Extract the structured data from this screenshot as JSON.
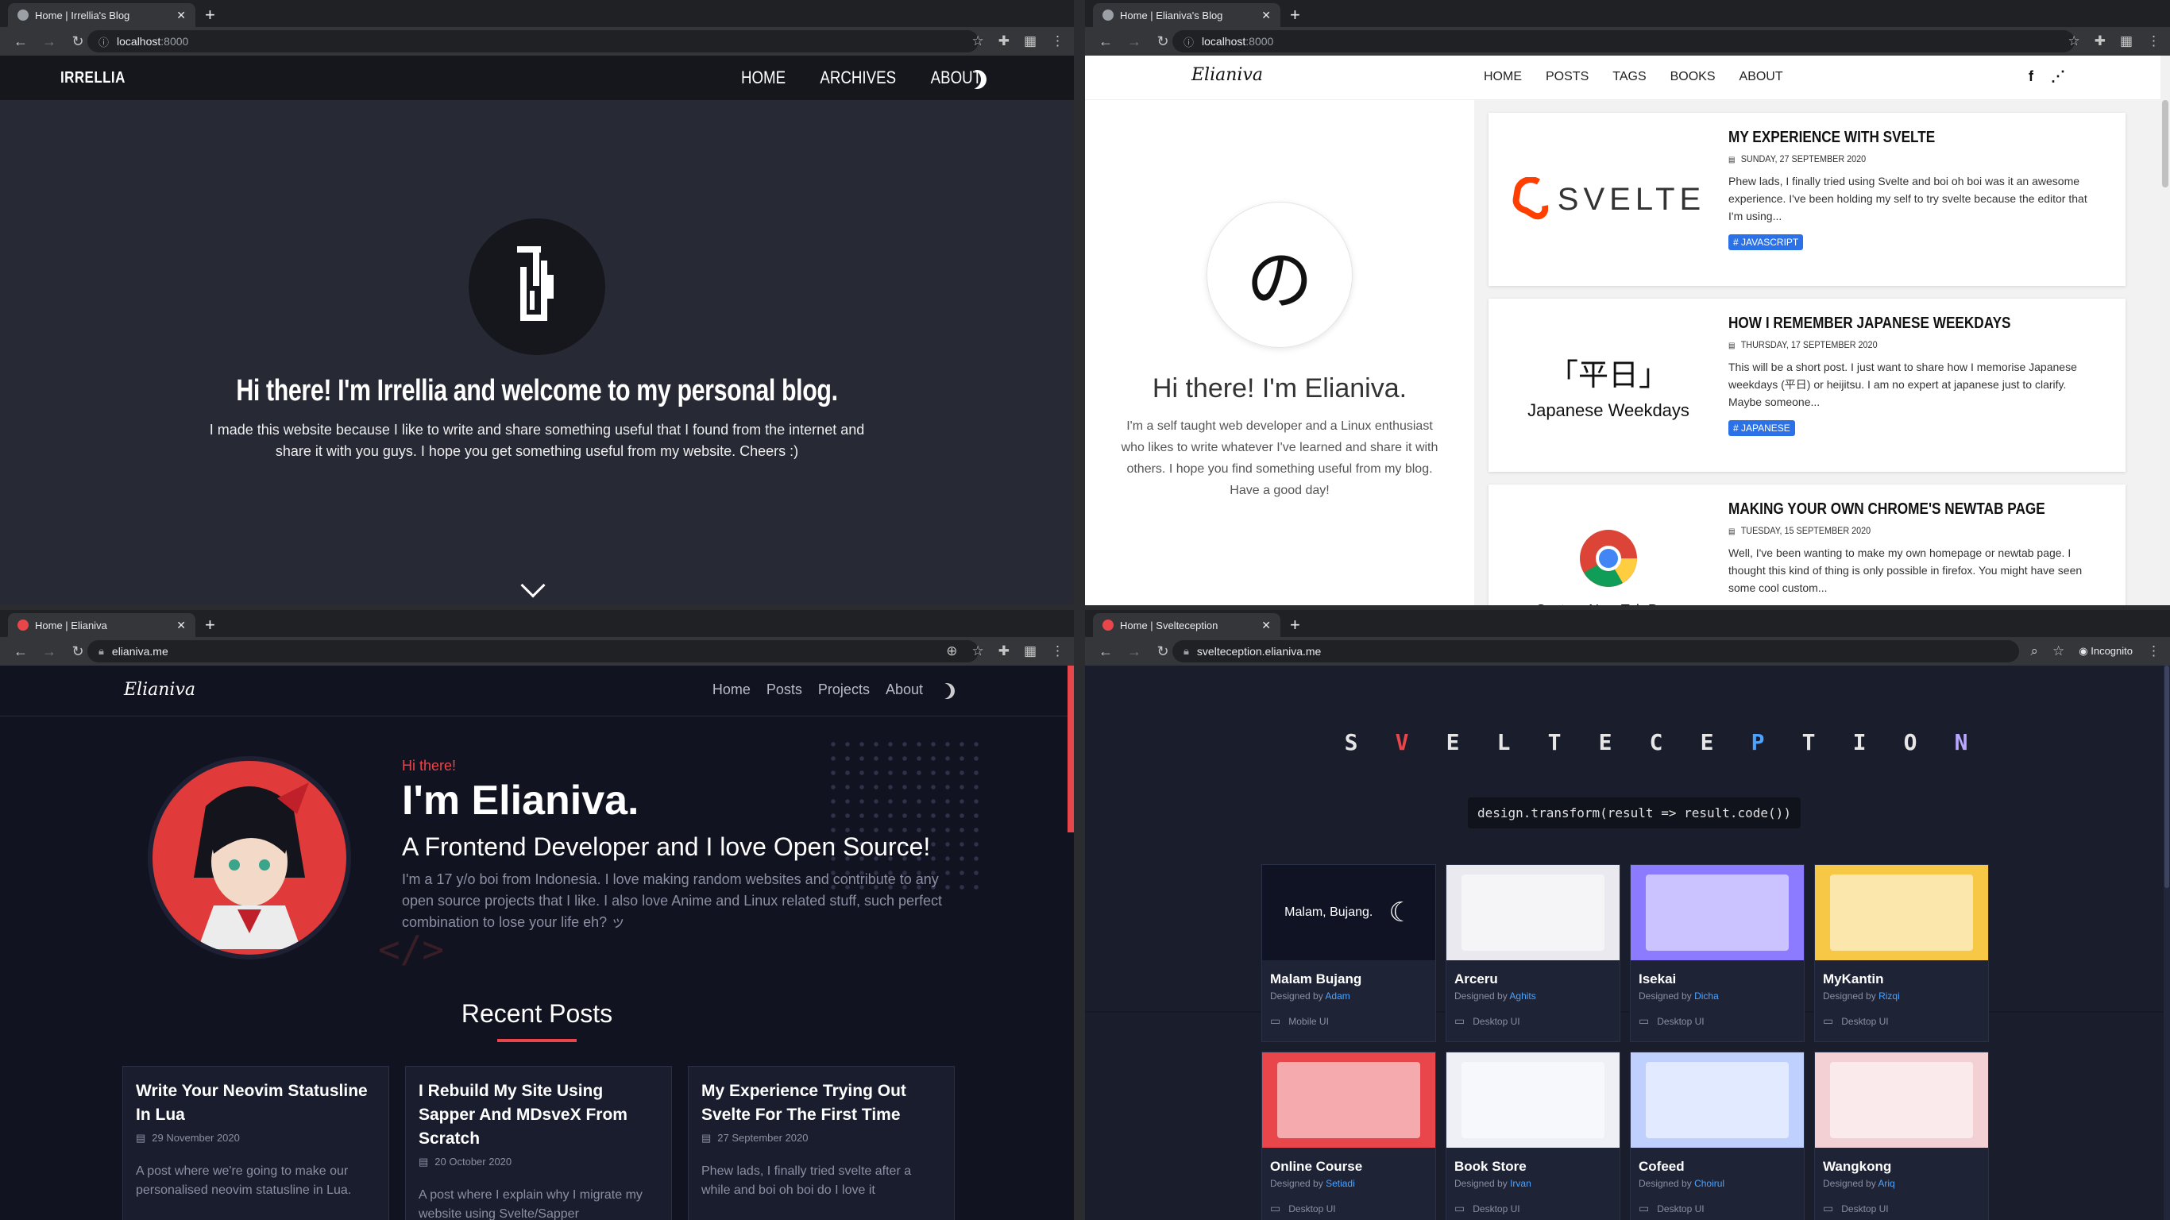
{
  "q1": {
    "tab_title": "Home | Irrellia's Blog",
    "url_host": "localhost",
    "url_port": ":8000",
    "brand": "IRRELLIA",
    "nav": [
      "HOME",
      "ARCHIVES",
      "ABOUT"
    ],
    "heading": "Hi there! I'm Irrellia and welcome to my personal blog.",
    "intro": "I made this website because I like to write and share something useful that I found from the internet and share it with you guys. I hope you get something useful from my website. Cheers :)"
  },
  "q2": {
    "tab_title": "Home | Elianiva's Blog",
    "url_host": "localhost",
    "url_port": ":8000",
    "brand": "Elianiva",
    "nav": [
      "HOME",
      "POSTS",
      "TAGS",
      "BOOKS",
      "ABOUT"
    ],
    "avatar_glyph": "の",
    "heading": "Hi there! I'm Elianiva.",
    "intro": "I'm a self taught web developer and a Linux enthusiast who likes to write whatever I've learned and share it with others. I hope you find something useful from my blog. Have a good day!",
    "posts": [
      {
        "title": "MY EXPERIENCE WITH SVELTE",
        "date": "SUNDAY, 27 SEPTEMBER 2020",
        "excerpt": "Phew lads, I finally tried using Svelte and boi oh boi was it an awesome experience. I've been holding my self to try svelte because the editor that I'm using...",
        "tag": "# JAVASCRIPT",
        "thumb_text": "SVELTE"
      },
      {
        "title": "HOW I REMEMBER JAPANESE WEEKDAYS",
        "date": "THURSDAY, 17 SEPTEMBER 2020",
        "excerpt": "This will be a short post. I just want to share how I memorise Japanese weekdays (平日) or heijitsu. I am no expert at japanese just to clarify. Maybe someone...",
        "tag": "# JAPANESE",
        "thumb_kanji": "「平日」",
        "thumb_text": "Japanese Weekdays"
      },
      {
        "title": "MAKING YOUR OWN CHROME'S NEWTAB PAGE",
        "date": "TUESDAY, 15 SEPTEMBER 2020",
        "excerpt": "Well, I've been wanting to make my own homepage or newtab page. I thought this kind of thing is only possible in firefox. You might have seen some cool custom...",
        "thumb_text": "Custom New Tab Page"
      }
    ]
  },
  "q3": {
    "tab_title": "Home | Elianiva",
    "url": "elianiva.me",
    "brand": "Elianiva",
    "nav": [
      "Home",
      "Posts",
      "Projects",
      "About"
    ],
    "hi": "Hi there!",
    "name": "I'm Elianiva.",
    "subtitle": "A Frontend Developer and I love Open Source!",
    "bio": "I'm a 17 y/o boi from Indonesia. I love making random websites and contribute to any open source projects that I like. I also love Anime and Linux related stuff, such perfect combination to lose your life eh? ッ",
    "code_deco": "</>",
    "recent_title": "Recent Posts",
    "posts": [
      {
        "title": "Write Your Neovim Statusline In Lua",
        "date": "29 November 2020",
        "excerpt": "A post where we're going to make our personalised neovim statusline in Lua."
      },
      {
        "title": "I Rebuild My Site Using Sapper And MDsveX From Scratch",
        "date": "20 October 2020",
        "excerpt": "A post where I explain why I migrate my website using Svelte/Sapper"
      },
      {
        "title": "My Experience Trying Out Svelte For The First Time",
        "date": "27 September 2020",
        "excerpt": "Phew lads, I finally tried svelte after a while and boi oh boi do I love it"
      }
    ]
  },
  "q4": {
    "tab_title": "Home | Svelteception",
    "url": "svelteception.elianiva.me",
    "incognito": "Incognito",
    "logo_letters": [
      "S",
      "V",
      "E",
      "L",
      "T",
      "E",
      "C",
      "E",
      "P",
      "T",
      "I",
      "O",
      "N"
    ],
    "code_line": "design.transform(result => result.code())",
    "designed_by_label": "Designed by",
    "designs": [
      {
        "name": "Malam Bujang",
        "author": "Adam",
        "platform": "Mobile UI",
        "shot_text": "Malam, Bujang.",
        "color": "#0f1324"
      },
      {
        "name": "Arceru",
        "author": "Aghits",
        "platform": "Desktop UI",
        "color": "#e9e9ef"
      },
      {
        "name": "Isekai",
        "author": "Dicha",
        "platform": "Desktop UI",
        "color": "#8c7bff"
      },
      {
        "name": "MyKantin",
        "author": "Rizqi",
        "platform": "Desktop UI",
        "color": "#f7c845"
      },
      {
        "name": "Online Course",
        "author": "Setiadi",
        "platform": "Desktop UI",
        "color": "#e8464a"
      },
      {
        "name": "Book Store",
        "author": "Irvan",
        "platform": "Desktop UI",
        "color": "#eef0f5"
      },
      {
        "name": "Cofeed",
        "author": "Choirul",
        "platform": "Desktop UI",
        "color": "#bfd0ff"
      },
      {
        "name": "Wangkong",
        "author": "Ariq",
        "platform": "Desktop UI",
        "color": "#f3d0d4"
      }
    ]
  }
}
